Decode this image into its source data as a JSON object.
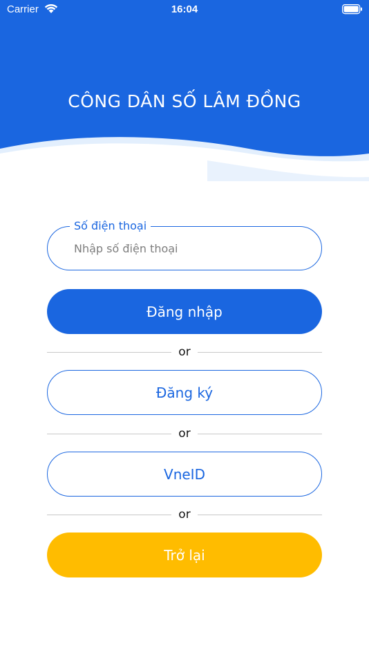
{
  "status_bar": {
    "carrier": "Carrier",
    "time": "16:04",
    "wifi_icon": "wifi-icon",
    "battery_icon": "battery-icon"
  },
  "header": {
    "title": "CÔNG DÂN SỐ LÂM ĐỒNG",
    "background_color": "#1a66e0",
    "wave_color": "#e3effd"
  },
  "phone_field": {
    "label": "Số điện thoại",
    "placeholder": "Nhập số điện thoại",
    "value": ""
  },
  "buttons": {
    "login": "Đăng nhập",
    "register": "Đăng ký",
    "vneid": "VneID",
    "back": "Trở lại"
  },
  "dividers": {
    "or_1": "or",
    "or_2": "or",
    "or_3": "or"
  },
  "colors": {
    "primary": "#1a66e0",
    "back_button": "#ffbc00"
  }
}
